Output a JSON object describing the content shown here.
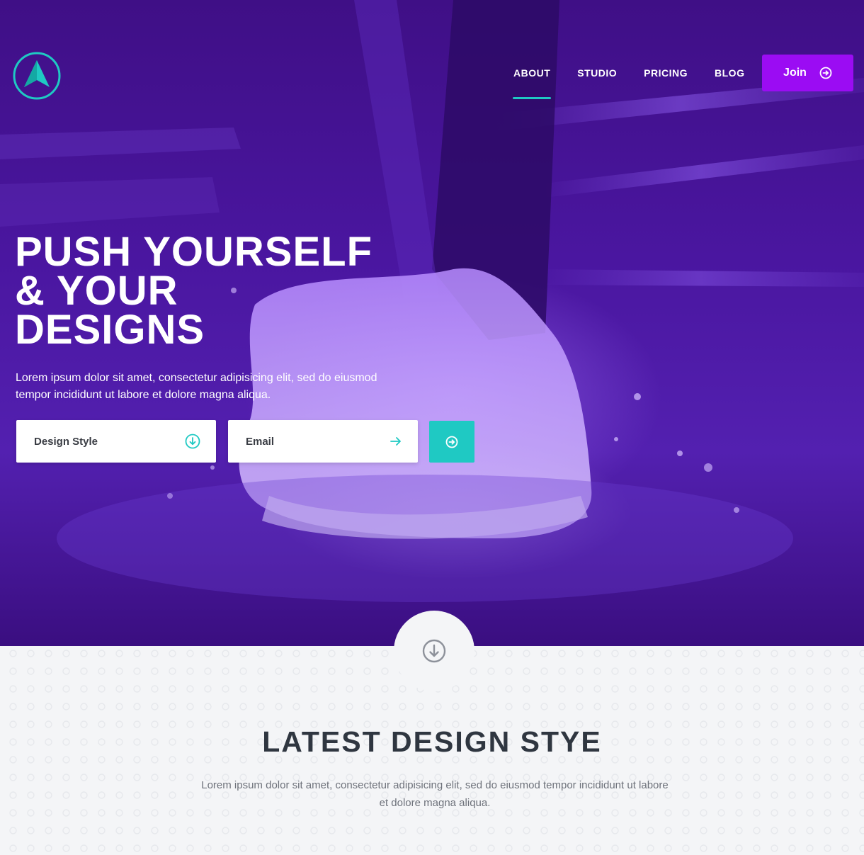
{
  "nav": {
    "items": [
      {
        "label": "ABOUT",
        "active": true
      },
      {
        "label": "STUDIO",
        "active": false
      },
      {
        "label": "PRICING",
        "active": false
      },
      {
        "label": "BLOG",
        "active": false
      }
    ],
    "join_label": "Join"
  },
  "hero": {
    "title_lines": [
      "PUSH YOURSELF",
      "& YOUR",
      "DESIGNS"
    ],
    "subtitle": "Lorem ipsum dolor sit amet, consectetur adipisicing elit, sed do eiusmod tempor incididunt ut labore et dolore magna aliqua.",
    "design_style_label": "Design Style",
    "email_label": "Email"
  },
  "section": {
    "title": "LATEST DESIGN STYE",
    "subtitle": "Lorem ipsum dolor sit amet, consectetur adipisicing elit, sed do eiusmod tempor incididunt ut labore et dolore magna aliqua."
  },
  "colors": {
    "accent_teal": "#1fc9c3",
    "join_purple": "#9b0cf3",
    "hero_purple": "#4a16a0"
  },
  "icons": {
    "logo": "arrow-logo-icon",
    "join": "arrow-circle-right-icon",
    "design_style": "arrow-circle-down-icon",
    "email": "arrow-right-icon",
    "submit": "arrow-circle-right-icon",
    "scroll": "arrow-circle-down-icon"
  }
}
